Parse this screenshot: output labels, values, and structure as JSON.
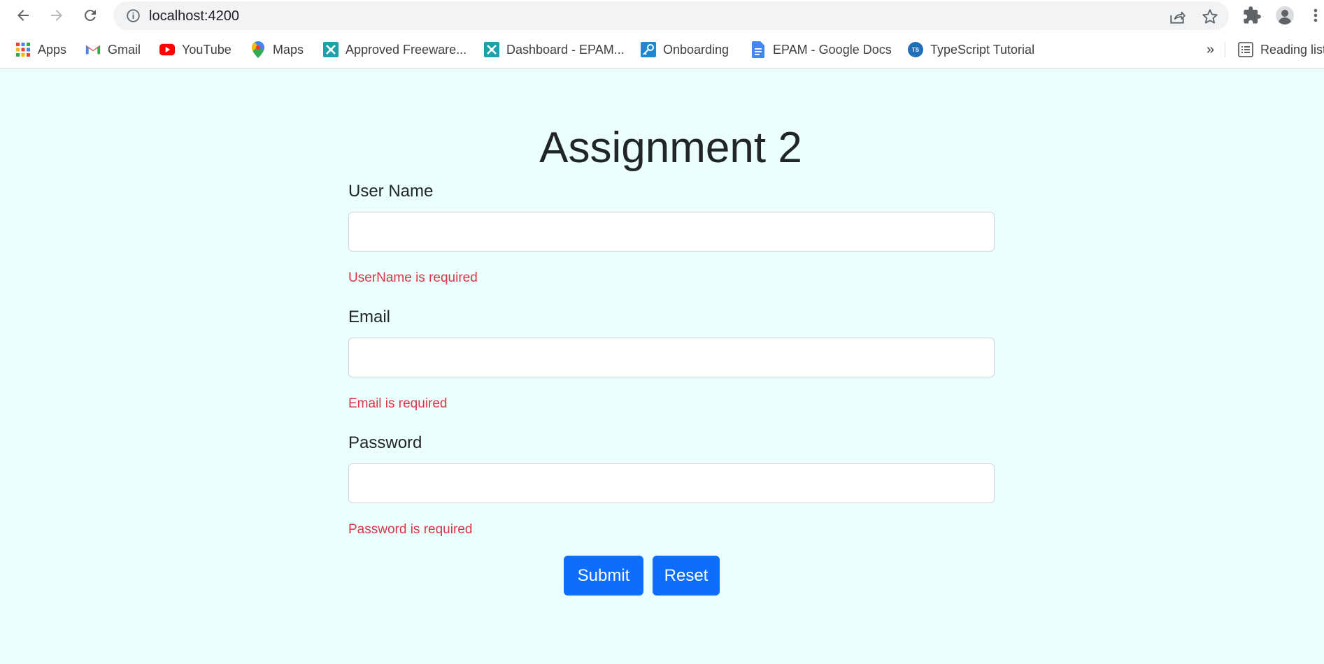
{
  "browser": {
    "url": "localhost:4200",
    "bookmarks": [
      {
        "label": "Apps",
        "icon": "apps-grid-icon"
      },
      {
        "label": "Gmail",
        "icon": "gmail-icon"
      },
      {
        "label": "YouTube",
        "icon": "youtube-icon"
      },
      {
        "label": "Maps",
        "icon": "maps-pin-icon"
      },
      {
        "label": "Approved Freeware...",
        "icon": "approved-freeware-icon"
      },
      {
        "label": "Dashboard - EPAM...",
        "icon": "dashboard-epam-icon"
      },
      {
        "label": "Onboarding",
        "icon": "key-icon"
      },
      {
        "label": "EPAM - Google Docs",
        "icon": "google-docs-icon"
      },
      {
        "label": "TypeScript Tutorial",
        "icon": "typescript-icon"
      }
    ],
    "overflow_label": "»",
    "reading_list_label": "Reading list",
    "ts_badge": "TS"
  },
  "form": {
    "title": "Assignment 2",
    "fields": [
      {
        "label": "User Name",
        "value": "",
        "error": "UserName is required"
      },
      {
        "label": "Email",
        "value": "",
        "error": "Email is required"
      },
      {
        "label": "Password",
        "value": "",
        "error": "Password is required"
      }
    ],
    "submit_label": "Submit",
    "reset_label": "Reset"
  },
  "colors": {
    "page_background": "#ebffff",
    "primary_button": "#0d6efd",
    "error_text": "#dc3545"
  }
}
